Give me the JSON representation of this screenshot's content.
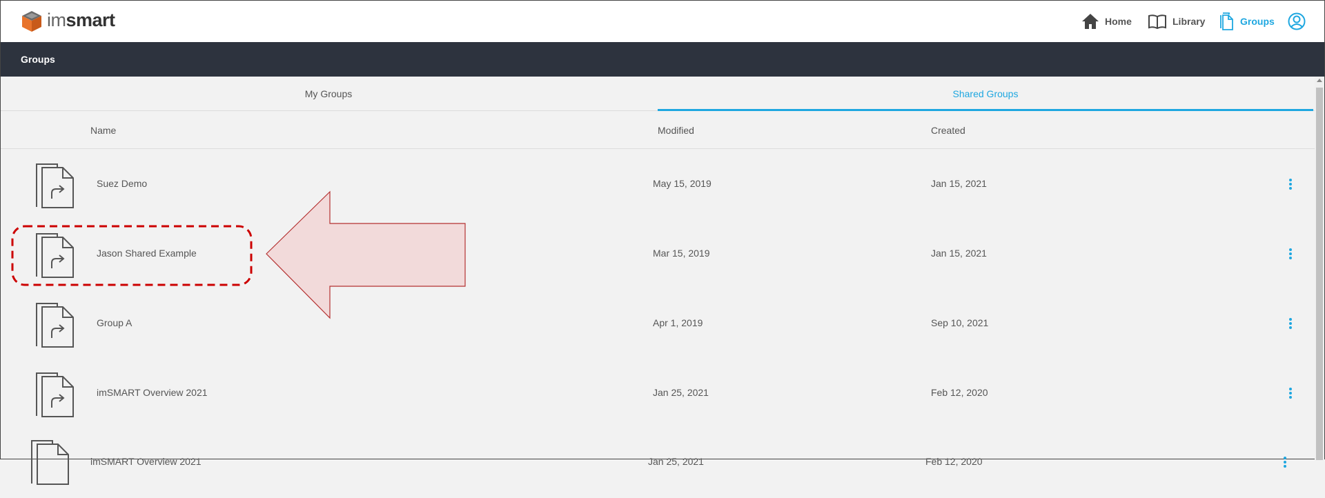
{
  "app": {
    "logo_light": "im",
    "logo_bold": "smart"
  },
  "nav": {
    "home": "Home",
    "library": "Library",
    "groups": "Groups"
  },
  "header": {
    "title": "Groups"
  },
  "tabs": [
    {
      "label": "My Groups",
      "active": false
    },
    {
      "label": "Shared Groups",
      "active": true
    }
  ],
  "columns": {
    "name": "Name",
    "modified": "Modified",
    "created": "Created"
  },
  "rows": [
    {
      "name": "Suez Demo",
      "modified": "May 15, 2019",
      "created": "Jan 15, 2021"
    },
    {
      "name": "Jason Shared Example",
      "modified": "Mar 15, 2019",
      "created": "Jan 15, 2021"
    },
    {
      "name": "Group A",
      "modified": "Apr 1, 2019",
      "created": "Sep 10, 2021"
    },
    {
      "name": "imSMART Overview 2021",
      "modified": "Jan 25, 2021",
      "created": "Feb 12, 2020"
    },
    {
      "name": "imSMART Overview 2021",
      "modified": "Jan 25, 2021",
      "created": "Feb 12, 2020"
    }
  ],
  "colors": {
    "accent": "#1ea7e0",
    "header_bg": "#2d333e",
    "annotation_red": "#cc0000",
    "arrow_fill": "#f2dada",
    "logo_orange": "#e8742c"
  }
}
